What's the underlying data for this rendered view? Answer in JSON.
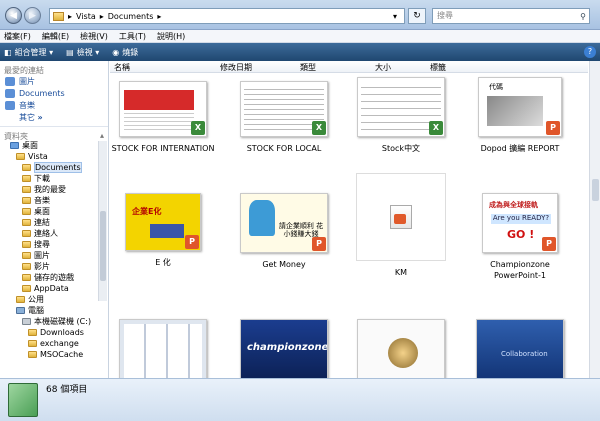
{
  "address": {
    "segments": [
      "Vista",
      "Documents"
    ],
    "search_placeholder": "搜尋"
  },
  "menu": [
    "檔案(F)",
    "編輯(E)",
    "檢視(V)",
    "工具(T)",
    "說明(H)"
  ],
  "toolbar": {
    "organize": "組合管理",
    "views": "檢視",
    "burn": "燒錄"
  },
  "favorites": {
    "header": "最愛的連結",
    "items": [
      "圖片",
      "Documents",
      "音樂"
    ],
    "more": "其它"
  },
  "folders": {
    "header": "資料夾",
    "items": [
      "桌面",
      "Vista",
      "Documents",
      "下載",
      "我的最愛",
      "音樂",
      "桌面",
      "連結",
      "連絡人",
      "搜尋",
      "圖片",
      "影片",
      "儲存的遊戲",
      "AppData",
      "公用",
      "電腦",
      "本機磁碟機 (C:)",
      "Downloads",
      "exchange",
      "MSOCache"
    ]
  },
  "columns": [
    "名稱",
    "修改日期",
    "類型",
    "大小",
    "標籤"
  ],
  "files": [
    {
      "name": "STOCK FOR INTERNATION",
      "kind": "excel"
    },
    {
      "name": "STOCK FOR LOCAL",
      "kind": "excel"
    },
    {
      "name": "Stock中文",
      "kind": "excel"
    },
    {
      "name": "Dopod 擴編 REPORT",
      "kind": "ppt"
    },
    {
      "name": "E 化",
      "kind": "ppt"
    },
    {
      "name": "Get Money",
      "kind": "ppt"
    },
    {
      "name": "KM",
      "kind": "ppt"
    },
    {
      "name": "Championzone PowerPoint-1",
      "kind": "ppt"
    },
    {
      "name": "",
      "kind": "other"
    },
    {
      "name": "",
      "kind": "ppt"
    },
    {
      "name": "",
      "kind": "ppt"
    },
    {
      "name": "",
      "kind": "ppt"
    }
  ],
  "thumb_text": {
    "dopod": "代碼",
    "e": "企業E化",
    "getmoney": "請企業順利 花小錢賺大錢",
    "champ_title": "成為與全球接軌",
    "champ_ready": "Are you READY?",
    "champ_go": "GO !",
    "championzone": "championzone",
    "collab": "Collaboration"
  },
  "status": {
    "count": "68 個項目"
  }
}
